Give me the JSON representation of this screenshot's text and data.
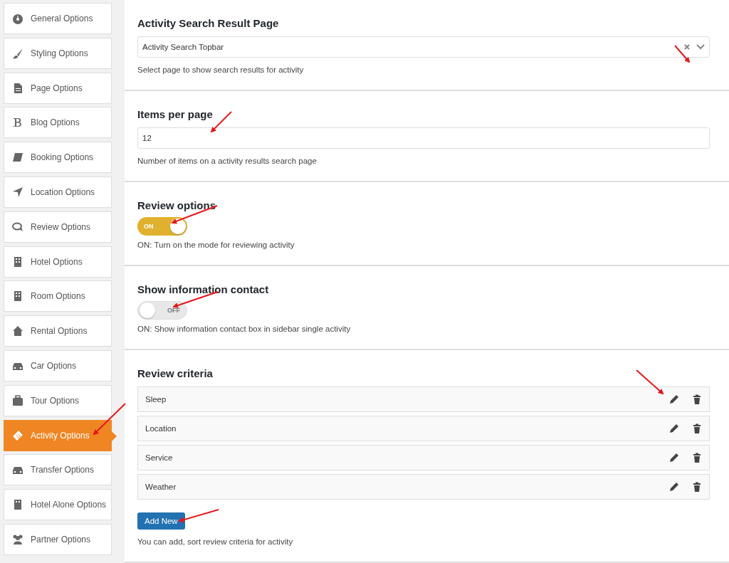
{
  "sidebar": {
    "items": [
      {
        "label": "General Options",
        "selected": false
      },
      {
        "label": "Styling Options",
        "selected": false
      },
      {
        "label": "Page Options",
        "selected": false
      },
      {
        "label": "Blog Options",
        "selected": false
      },
      {
        "label": "Booking Options",
        "selected": false
      },
      {
        "label": "Location Options",
        "selected": false
      },
      {
        "label": "Review Options",
        "selected": false
      },
      {
        "label": "Hotel Options",
        "selected": false
      },
      {
        "label": "Room Options",
        "selected": false
      },
      {
        "label": "Rental Options",
        "selected": false
      },
      {
        "label": "Car Options",
        "selected": false
      },
      {
        "label": "Tour Options",
        "selected": false
      },
      {
        "label": "Activity Options",
        "selected": true
      },
      {
        "label": "Transfer Options",
        "selected": false
      },
      {
        "label": "Hotel Alone Options",
        "selected": false
      },
      {
        "label": "Partner Options",
        "selected": false
      }
    ]
  },
  "sections": [
    {
      "kind": "select",
      "title": "Activity Search Result Page",
      "value": "Activity Search Topbar",
      "description": "Select page to show search results for activity"
    },
    {
      "kind": "text",
      "title": "Items per page",
      "value": "12",
      "description": "Number of items on a activity results search page"
    },
    {
      "kind": "toggle",
      "title": "Review options",
      "on": true,
      "toggle_label": "ON",
      "description": "ON: Turn on the mode for reviewing activity"
    },
    {
      "kind": "toggle",
      "title": "Show information contact",
      "on": false,
      "toggle_label": "OFF",
      "description": "ON: Show information contact box in sidebar single activity"
    },
    {
      "kind": "list",
      "title": "Review criteria",
      "items": [
        "Sleep",
        "Location",
        "Service",
        "Weather"
      ],
      "button": "Add New",
      "description": "You can add, sort review criteria for activity"
    }
  ]
}
